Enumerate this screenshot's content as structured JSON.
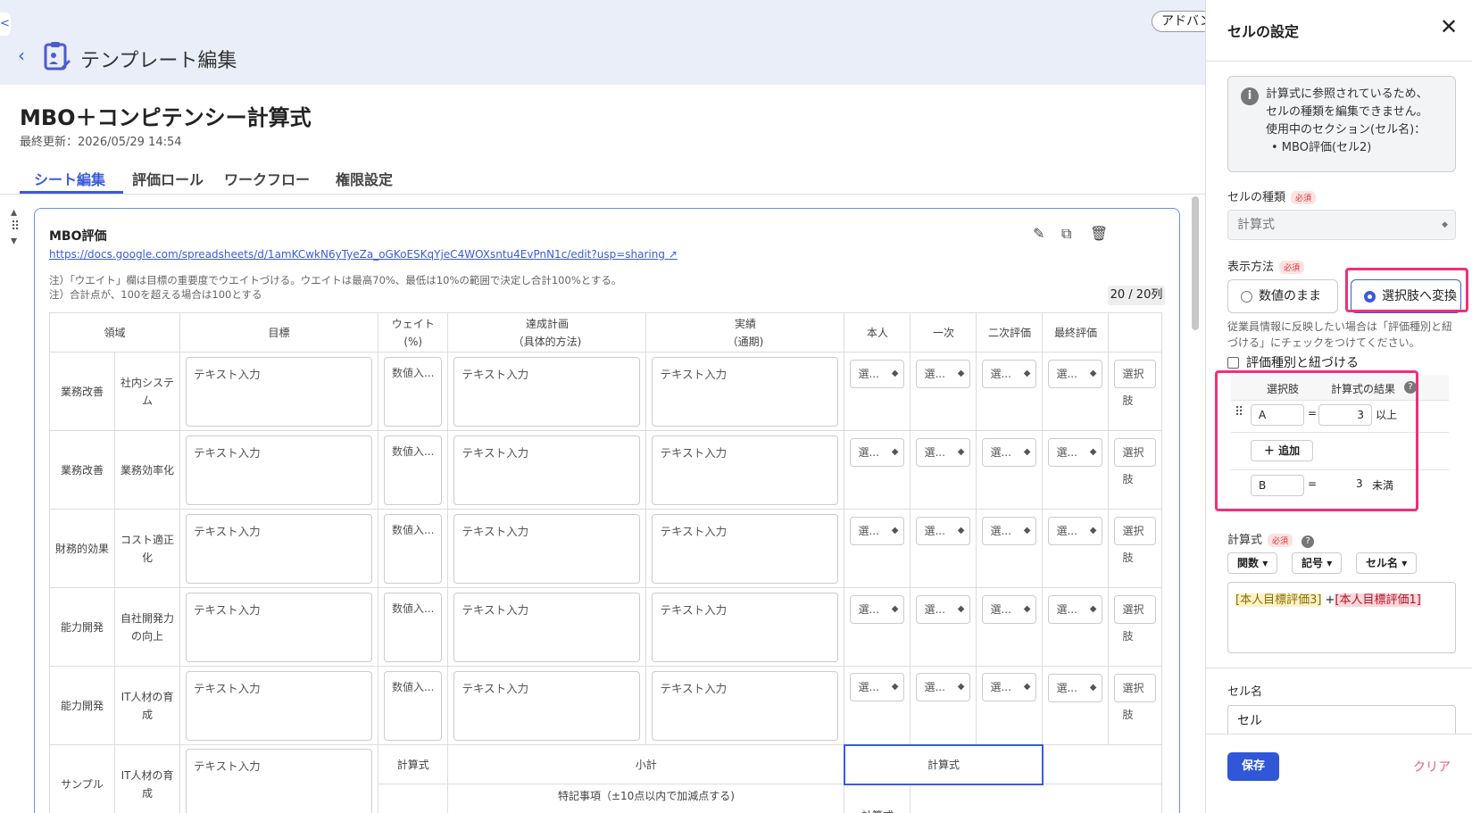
{
  "header": {
    "title": "テンプレート編集",
    "advanced_label": "アドバン"
  },
  "document": {
    "title": "MBO＋コンピテンシー計算式",
    "updated": "最終更新：2026/05/29 14:54"
  },
  "tabs": [
    {
      "label": "シート編集"
    },
    {
      "label": "評価ロール"
    },
    {
      "label": "ワークフロー"
    },
    {
      "label": "権限設定"
    }
  ],
  "card": {
    "title": "MBO評価",
    "link": "https://docs.google.com/spreadsheets/d/1amKCwkN6yTyeZa_oGKoESKqYjeC4WOXsntu4EvPnN1c/edit?usp=sharing",
    "note1": "注）「ウエイト」欄は目標の重要度でウエイトづける。ウエイトは最高70%、最低は10%の範囲で決定し合計100%とする。",
    "note2": "注）合計点が、100を超える場合は100とする",
    "column_count": "20 / 20列"
  },
  "table": {
    "headers": [
      "領域",
      "目標",
      "ウェイト",
      "(%)",
      "達成計画",
      "（具体的方法)",
      "実績",
      "（通期)",
      "本人",
      "一次",
      "二次評価",
      "最終評価"
    ],
    "text_placeholder": "テキスト入力",
    "num_placeholder": "数値入...",
    "select_placeholder": "選...",
    "select_placeholder_wide": "選択肢",
    "rows": [
      {
        "area": "業務改善",
        "sub": "社内システム"
      },
      {
        "area": "業務改善",
        "sub": "業務効率化"
      },
      {
        "area": "財務的効果",
        "sub": "コスト適正化"
      },
      {
        "area": "能力開発",
        "sub": "自社開発力の向上"
      },
      {
        "area": "能力開発",
        "sub": "IT人材の育成"
      }
    ],
    "sample": {
      "area": "サンプル",
      "sub": "IT人材の育成",
      "formula1": "計算式",
      "subtotal": "小計",
      "formula2": "計算式",
      "special": "特記事項（±10点以内で加減点する)",
      "formula3": "計算式"
    }
  },
  "panel": {
    "title": "セルの設定",
    "info_lines": [
      "計算式に参照されているため、",
      "セルの種類を編集できません。",
      "使用中のセクション(セル名)：",
      "• MBO評価(セル2)"
    ],
    "cell_type_label": "セルの種類",
    "required": "必須",
    "cell_type_value": "計算式",
    "display_label": "表示方法",
    "radio_raw": "数値のまま",
    "radio_choice": "選択肢へ変換",
    "hint": "従業員情報に反映したい場合は「評価種別と紐づける」にチェックをつけてください。",
    "link_checkbox": "評価種別と紐づける",
    "choices_head_1": "選択肢",
    "choices_head_2": "計算式の結果",
    "choice_a": "A",
    "choice_a_value": "3",
    "choice_a_suffix": "以上",
    "add_label": "追加",
    "choice_b": "B",
    "choice_b_value": "3",
    "choice_b_suffix": "未満",
    "eq": "=",
    "formula_label": "計算式",
    "func_btn": "関数",
    "sym_btn": "記号",
    "cellname_btn": "セル名",
    "token1": "[本人目標評価3]",
    "op": " +",
    "token2": "[本人目標評価1]",
    "cell_name_label": "セル名",
    "cell_name_value": "セル",
    "save_label": "保存",
    "clear_label": "クリア"
  }
}
